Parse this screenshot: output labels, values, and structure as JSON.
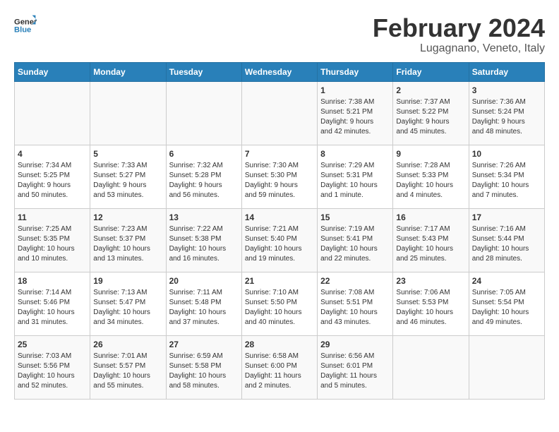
{
  "header": {
    "logo_general": "General",
    "logo_blue": "Blue",
    "title": "February 2024",
    "location": "Lugagnano, Veneto, Italy"
  },
  "weekdays": [
    "Sunday",
    "Monday",
    "Tuesday",
    "Wednesday",
    "Thursday",
    "Friday",
    "Saturday"
  ],
  "weeks": [
    [
      {
        "day": "",
        "info": ""
      },
      {
        "day": "",
        "info": ""
      },
      {
        "day": "",
        "info": ""
      },
      {
        "day": "",
        "info": ""
      },
      {
        "day": "1",
        "info": "Sunrise: 7:38 AM\nSunset: 5:21 PM\nDaylight: 9 hours\nand 42 minutes."
      },
      {
        "day": "2",
        "info": "Sunrise: 7:37 AM\nSunset: 5:22 PM\nDaylight: 9 hours\nand 45 minutes."
      },
      {
        "day": "3",
        "info": "Sunrise: 7:36 AM\nSunset: 5:24 PM\nDaylight: 9 hours\nand 48 minutes."
      }
    ],
    [
      {
        "day": "4",
        "info": "Sunrise: 7:34 AM\nSunset: 5:25 PM\nDaylight: 9 hours\nand 50 minutes."
      },
      {
        "day": "5",
        "info": "Sunrise: 7:33 AM\nSunset: 5:27 PM\nDaylight: 9 hours\nand 53 minutes."
      },
      {
        "day": "6",
        "info": "Sunrise: 7:32 AM\nSunset: 5:28 PM\nDaylight: 9 hours\nand 56 minutes."
      },
      {
        "day": "7",
        "info": "Sunrise: 7:30 AM\nSunset: 5:30 PM\nDaylight: 9 hours\nand 59 minutes."
      },
      {
        "day": "8",
        "info": "Sunrise: 7:29 AM\nSunset: 5:31 PM\nDaylight: 10 hours\nand 1 minute."
      },
      {
        "day": "9",
        "info": "Sunrise: 7:28 AM\nSunset: 5:33 PM\nDaylight: 10 hours\nand 4 minutes."
      },
      {
        "day": "10",
        "info": "Sunrise: 7:26 AM\nSunset: 5:34 PM\nDaylight: 10 hours\nand 7 minutes."
      }
    ],
    [
      {
        "day": "11",
        "info": "Sunrise: 7:25 AM\nSunset: 5:35 PM\nDaylight: 10 hours\nand 10 minutes."
      },
      {
        "day": "12",
        "info": "Sunrise: 7:23 AM\nSunset: 5:37 PM\nDaylight: 10 hours\nand 13 minutes."
      },
      {
        "day": "13",
        "info": "Sunrise: 7:22 AM\nSunset: 5:38 PM\nDaylight: 10 hours\nand 16 minutes."
      },
      {
        "day": "14",
        "info": "Sunrise: 7:21 AM\nSunset: 5:40 PM\nDaylight: 10 hours\nand 19 minutes."
      },
      {
        "day": "15",
        "info": "Sunrise: 7:19 AM\nSunset: 5:41 PM\nDaylight: 10 hours\nand 22 minutes."
      },
      {
        "day": "16",
        "info": "Sunrise: 7:17 AM\nSunset: 5:43 PM\nDaylight: 10 hours\nand 25 minutes."
      },
      {
        "day": "17",
        "info": "Sunrise: 7:16 AM\nSunset: 5:44 PM\nDaylight: 10 hours\nand 28 minutes."
      }
    ],
    [
      {
        "day": "18",
        "info": "Sunrise: 7:14 AM\nSunset: 5:46 PM\nDaylight: 10 hours\nand 31 minutes."
      },
      {
        "day": "19",
        "info": "Sunrise: 7:13 AM\nSunset: 5:47 PM\nDaylight: 10 hours\nand 34 minutes."
      },
      {
        "day": "20",
        "info": "Sunrise: 7:11 AM\nSunset: 5:48 PM\nDaylight: 10 hours\nand 37 minutes."
      },
      {
        "day": "21",
        "info": "Sunrise: 7:10 AM\nSunset: 5:50 PM\nDaylight: 10 hours\nand 40 minutes."
      },
      {
        "day": "22",
        "info": "Sunrise: 7:08 AM\nSunset: 5:51 PM\nDaylight: 10 hours\nand 43 minutes."
      },
      {
        "day": "23",
        "info": "Sunrise: 7:06 AM\nSunset: 5:53 PM\nDaylight: 10 hours\nand 46 minutes."
      },
      {
        "day": "24",
        "info": "Sunrise: 7:05 AM\nSunset: 5:54 PM\nDaylight: 10 hours\nand 49 minutes."
      }
    ],
    [
      {
        "day": "25",
        "info": "Sunrise: 7:03 AM\nSunset: 5:56 PM\nDaylight: 10 hours\nand 52 minutes."
      },
      {
        "day": "26",
        "info": "Sunrise: 7:01 AM\nSunset: 5:57 PM\nDaylight: 10 hours\nand 55 minutes."
      },
      {
        "day": "27",
        "info": "Sunrise: 6:59 AM\nSunset: 5:58 PM\nDaylight: 10 hours\nand 58 minutes."
      },
      {
        "day": "28",
        "info": "Sunrise: 6:58 AM\nSunset: 6:00 PM\nDaylight: 11 hours\nand 2 minutes."
      },
      {
        "day": "29",
        "info": "Sunrise: 6:56 AM\nSunset: 6:01 PM\nDaylight: 11 hours\nand 5 minutes."
      },
      {
        "day": "",
        "info": ""
      },
      {
        "day": "",
        "info": ""
      }
    ]
  ]
}
